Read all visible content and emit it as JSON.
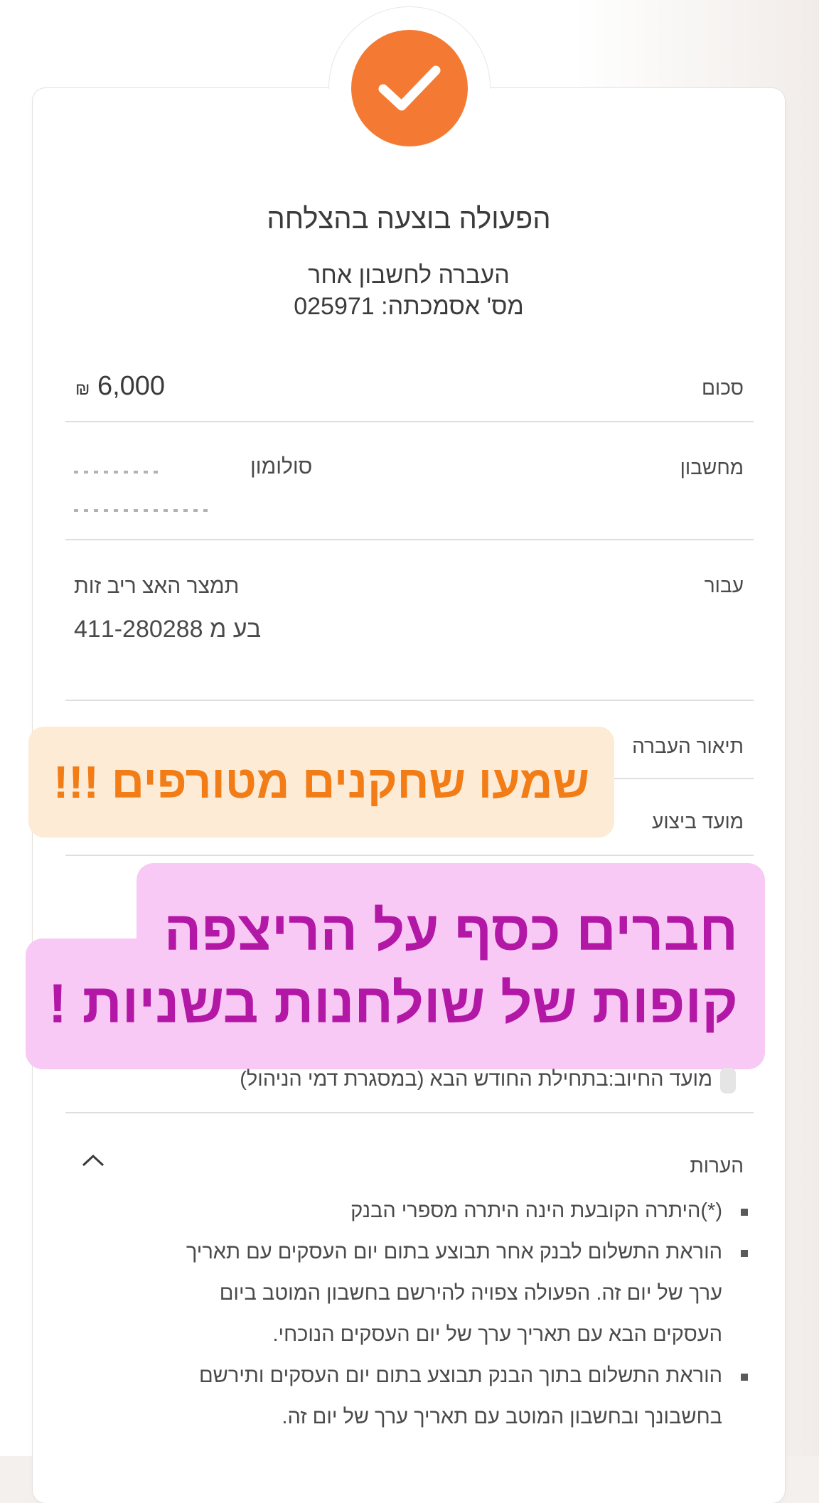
{
  "success_icon": {
    "name": "check-icon",
    "color": "#f47a34"
  },
  "header": {
    "status": "הפעולה בוצעה בהצלחה",
    "operation": "העברה לחשבון אחר",
    "reference": "מס' אסמכתה: 025971"
  },
  "rows": {
    "amount_label": "סכום",
    "amount_value": "6,000",
    "currency_symbol": "₪",
    "account_label": "מחשבון",
    "account_name": "סולומון",
    "for_label": "עבור",
    "for_text": "תמצר האצ ריב זות",
    "for_number": "411-280288 בע מ",
    "description_label": "תיאור העברה",
    "execution_label": "מועד ביצוע"
  },
  "overlay1": {
    "text": "שמעו שחקנים מטורפים !!!"
  },
  "overlay2": {
    "line1": "חברים כסף על הריצפה",
    "line2": "קופות של שולחנות בשניות !"
  },
  "charge_line": "מועד החיוב:בתחילת החודש הבא (במסגרת דמי הניהול)",
  "notes": {
    "title": "הערות",
    "items": [
      "(*)היתרה הקובעת הינה היתרה מספרי הבנק",
      "הוראת התשלום לבנק אחר תבוצע בתום יום העסקים עם תאריך ערך של יום זה. הפעולה צפויה להירשם בחשבון המוטב ביום העסקים הבא עם תאריך ערך של יום העסקים הנוכחי.",
      "הוראת התשלום בתוך הבנק תבוצע בתום יום העסקים ותירשם בחשבונך ובחשבון המוטב עם תאריך ערך של יום זה."
    ]
  },
  "colors": {
    "accent_orange": "#f47a34",
    "banner_pink": "#f8c9f4",
    "banner_purple_text": "#b217a5",
    "banner_peach": "#fdebd6",
    "banner_orange_text": "#f27c16"
  }
}
